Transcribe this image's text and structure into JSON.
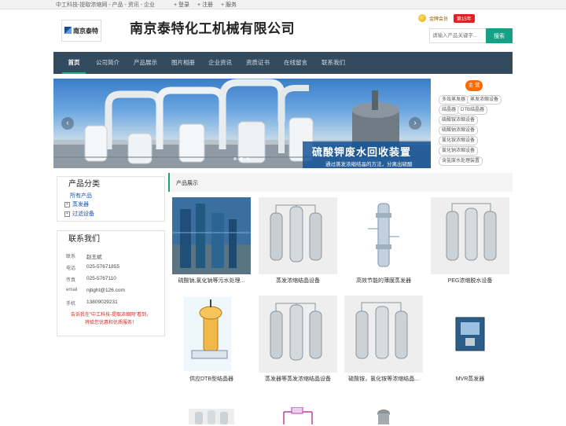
{
  "topbar": {
    "site": "中工科技-提取浓缩网 - 产品 - 资讯 - 企业",
    "login": "+ 登录",
    "register": "+ 注册",
    "service": "+ 服务"
  },
  "logo_text": "南京泰特",
  "company_name": "南京泰特化工机械有限公司",
  "badge": {
    "member": "金牌会员",
    "years": "第15年"
  },
  "search": {
    "placeholder": "请输入产品关键字...",
    "button": "搜索"
  },
  "nav": [
    "首页",
    "公司简介",
    "产品展示",
    "图片相册",
    "企业资讯",
    "资质证书",
    "在线留言",
    "联系我们"
  ],
  "banner": {
    "title": "硫酸钾废水回收装置",
    "subtitle": "通过蒸发浓缩结晶的方法，分离出硫酸",
    "prev": "‹",
    "next": "›"
  },
  "tags_button": "主 营",
  "tags": [
    "多效蒸发器",
    "蒸发浓缩设备",
    "结晶器",
    "DTB结晶器",
    "硫酸铵浓缩设备",
    "硫酸钠浓缩设备",
    "氯化铵浓缩设备",
    "氯化钠浓缩设备",
    "含盐废水处理装置"
  ],
  "categories": {
    "title": "产品分类",
    "all": "所有产品",
    "items": [
      "蒸发器",
      "过滤设备"
    ]
  },
  "contact": {
    "title": "联系我们",
    "rows": [
      {
        "k": "联系",
        "v": "赵玉斌"
      },
      {
        "k": "电话",
        "v": "025-57671855"
      },
      {
        "k": "传真",
        "v": "025-5767110"
      },
      {
        "k": "email",
        "v": "njtight@126.com"
      },
      {
        "k": "手机",
        "v": "13809029231"
      }
    ],
    "note1": "告诉我在\"中工科技-提取浓缩网\"看到，",
    "note2": "将给您优惠和优质服务！"
  },
  "main": {
    "title": "产品展示",
    "products": [
      "硫酸钠,氯化钠等污水处理...",
      "蒸发浓缩结晶设备",
      "高效节能的薄膜蒸发器",
      "PEG浓缩脱水设备",
      "供应DTB型结晶器",
      "蒸发器等蒸发浓缩结晶设备",
      "硫酸铵，氯化铵等浓缩结晶...",
      "MVR蒸发器"
    ]
  },
  "colors": {
    "nav_bg": "#344a5e",
    "accent": "#16a085",
    "badge_red": "#d9251d",
    "tag_orange": "#ff6a00"
  }
}
